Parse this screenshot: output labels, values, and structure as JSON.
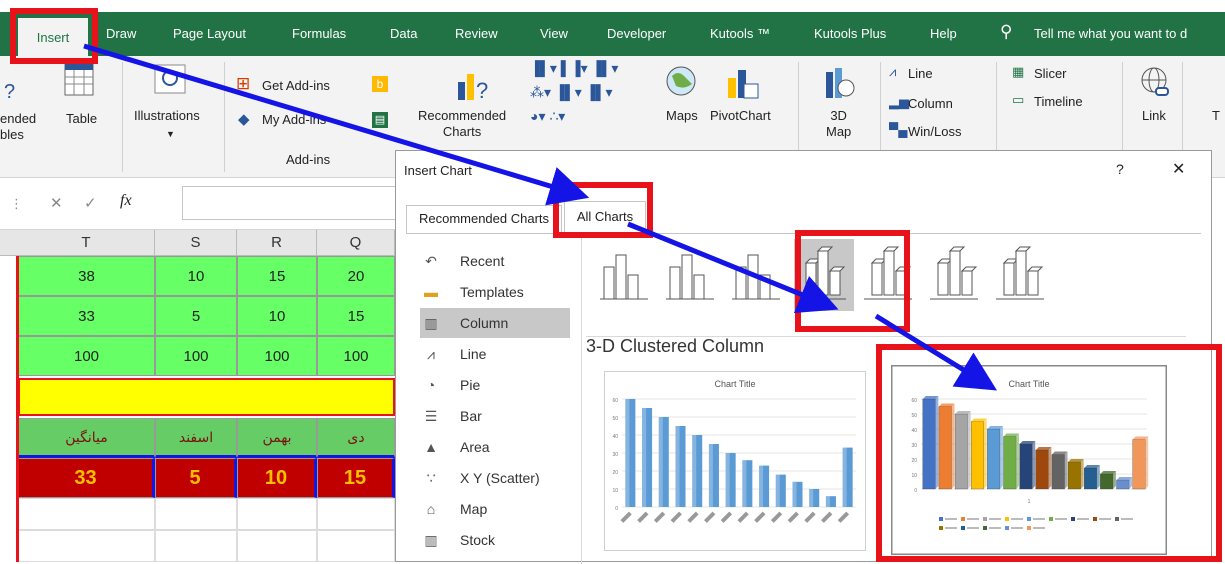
{
  "tabs": [
    "Insert",
    "Draw",
    "Page Layout",
    "Formulas",
    "Data",
    "Review",
    "View",
    "Developer",
    "Kutools ™",
    "Kutools Plus",
    "Help"
  ],
  "tell_me": "Tell me what you want to d",
  "ribbon": {
    "recommended_tables": [
      "ended",
      "bles"
    ],
    "table": "Table",
    "illustrations": "Illustrations",
    "get_addins": "Get Add-ins",
    "my_addins": "My Add-ins",
    "addins_group": "Add-ins",
    "recommended_charts": [
      "Recommended",
      "Charts"
    ],
    "maps": "Maps",
    "pivotchart": "PivotChart",
    "map3d": [
      "3D",
      "Map"
    ],
    "line": "Line",
    "column": "Column",
    "winloss": "Win/Loss",
    "slicer": "Slicer",
    "timeline": "Timeline",
    "link": "Link",
    "t_cut": "T"
  },
  "formula_bar": {
    "fx": "fx"
  },
  "sheet": {
    "columns": [
      "T",
      "S",
      "R",
      "Q"
    ],
    "rows": [
      [
        "38",
        "10",
        "15",
        "20"
      ],
      [
        "33",
        "5",
        "10",
        "15"
      ],
      [
        "100",
        "100",
        "100",
        "100"
      ]
    ],
    "headers": [
      "میانگین",
      "اسفند",
      "بهمن",
      "دی"
    ],
    "values": [
      "33",
      "5",
      "10",
      "15"
    ]
  },
  "dialog": {
    "title": "Insert Chart",
    "help": "?",
    "close": "✕",
    "tab_recommended": "Recommended Charts",
    "tab_all": "All Charts",
    "nav": [
      "Recent",
      "Templates",
      "Column",
      "Line",
      "Pie",
      "Bar",
      "Area",
      "X Y (Scatter)",
      "Map",
      "Stock"
    ],
    "subtype_title": "3-D Clustered Column",
    "preview_title": "Chart Title",
    "preview_axis_label": "1"
  },
  "chart_data": [
    {
      "type": "bar",
      "title": "Chart Title",
      "ylim": [
        0,
        60
      ],
      "ticks": [
        "60",
        "50",
        "40",
        "30",
        "20",
        "10",
        "0"
      ],
      "values": [
        60,
        55,
        50,
        45,
        40,
        35,
        30,
        26,
        23,
        18,
        14,
        10,
        6,
        33
      ]
    },
    {
      "type": "bar",
      "title": "Chart Title",
      "ylim": [
        0,
        60
      ],
      "ticks": [
        "60",
        "50",
        "40",
        "30",
        "20",
        "10",
        "0"
      ],
      "values": [
        60,
        55,
        50,
        45,
        40,
        35,
        30,
        26,
        23,
        18,
        14,
        10,
        6,
        33
      ],
      "colors": [
        "#4472c4",
        "#ed7d31",
        "#a5a5a5",
        "#ffc000",
        "#5b9bd5",
        "#70ad47",
        "#264478",
        "#9e480e",
        "#636363",
        "#997300",
        "#255e91",
        "#43682b",
        "#698ed0",
        "#f1975a"
      ]
    }
  ],
  "colors": {
    "excel_green": "#217346",
    "arrow_blue": "#1414e6",
    "highlight_red": "#e8121a",
    "cell_green": "#66ff66",
    "cell_yellow": "#ffff00",
    "cell_red": "#c00000"
  }
}
